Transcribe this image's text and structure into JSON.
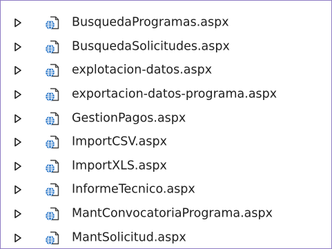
{
  "solution_explorer": {
    "items": [
      {
        "label": "BusquedaProgramas.aspx",
        "icon": "aspx-web-form-icon",
        "expanded": false
      },
      {
        "label": "BusquedaSolicitudes.aspx",
        "icon": "aspx-web-form-icon",
        "expanded": false
      },
      {
        "label": "explotacion-datos.aspx",
        "icon": "aspx-web-form-icon",
        "expanded": false
      },
      {
        "label": "exportacion-datos-programa.aspx",
        "icon": "aspx-web-form-icon",
        "expanded": false
      },
      {
        "label": "GestionPagos.aspx",
        "icon": "aspx-web-form-icon",
        "expanded": false
      },
      {
        "label": "ImportCSV.aspx",
        "icon": "aspx-web-form-icon",
        "expanded": false
      },
      {
        "label": "ImportXLS.aspx",
        "icon": "aspx-web-form-icon",
        "expanded": false
      },
      {
        "label": "InformeTecnico.aspx",
        "icon": "aspx-web-form-icon",
        "expanded": false
      },
      {
        "label": "MantConvocatoriaPrograma.aspx",
        "icon": "aspx-web-form-icon",
        "expanded": false
      },
      {
        "label": "MantSolicitud.aspx",
        "icon": "aspx-web-form-icon",
        "expanded": false
      }
    ]
  },
  "colors": {
    "frame_border": "#8e7bc4",
    "text": "#1e1e1e",
    "expander": "#1e1e1e",
    "globe_blue": "#1f6fc5",
    "page_outline": "#424242"
  }
}
